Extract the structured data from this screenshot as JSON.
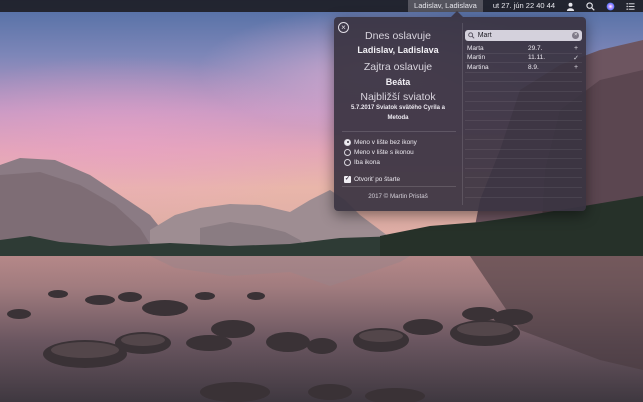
{
  "menubar": {
    "names": "Ladislav, Ladislava",
    "datetime": "ut 27. jún  22 40 44",
    "icons": [
      "user-icon",
      "spotlight-search-icon",
      "siri-icon",
      "notification-center-icon"
    ]
  },
  "popover": {
    "close_icon": "close-icon",
    "today_heading": "Dnes oslavuje",
    "today_names": "Ladislav, Ladislava",
    "tomorrow_heading": "Zajtra oslavuje",
    "tomorrow_name": "Beáta",
    "holiday_heading": "Najbližší sviatok",
    "holiday_text": "5.7.2017 Sviatok svätého Cyrila a Metoda",
    "options": [
      {
        "label": "Meno v lište bez ikony",
        "selected": true
      },
      {
        "label": "Meno v lište s ikonou",
        "selected": false
      },
      {
        "label": "Iba ikona",
        "selected": false
      }
    ],
    "launch_at_start": {
      "label": "Otvoriť po štarte",
      "checked": true
    },
    "copyright": "2017 © Martin Pristaš",
    "search": {
      "value": "Mart",
      "placeholder": ""
    },
    "results": [
      {
        "name": "Marta",
        "date": "29.7.",
        "action": "+"
      },
      {
        "name": "Martin",
        "date": "11.11.",
        "action": "✓"
      },
      {
        "name": "Martina",
        "date": "8.9.",
        "action": "+"
      }
    ],
    "empty_rows": 13
  },
  "colors": {
    "popover_bg": "#3a3442",
    "menubar_bg": "#1e1e26"
  }
}
